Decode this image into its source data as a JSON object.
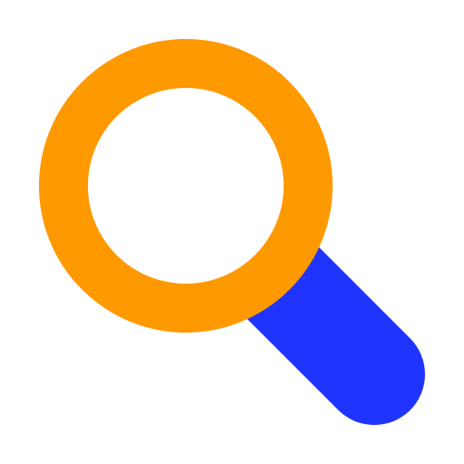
{
  "icon": {
    "name": "search-icon",
    "handle_color": "#1F35FF",
    "lens_color": "#FF9900",
    "background_color": "#FFFFFF"
  }
}
